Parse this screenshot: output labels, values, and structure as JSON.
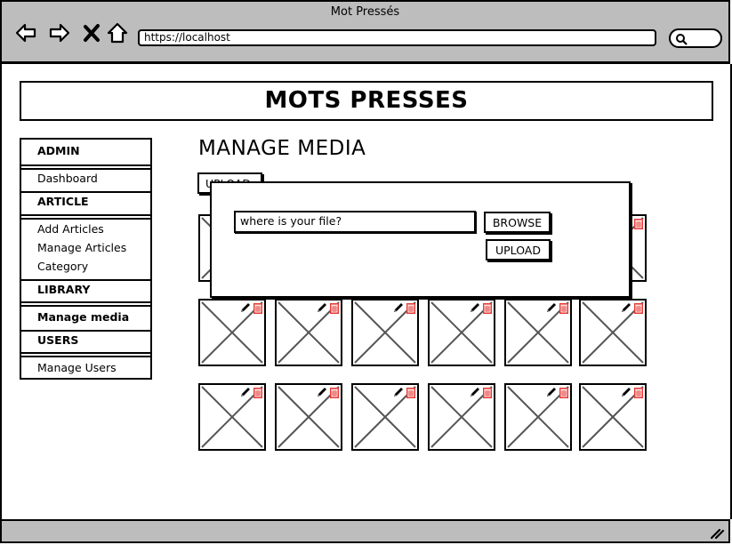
{
  "window": {
    "title": "Mot Pressés",
    "url": "https://localhost"
  },
  "app": {
    "title": "MOTS PRESSES"
  },
  "sidebar": {
    "sections": [
      {
        "heading": "ADMIN",
        "items": [
          "Dashboard"
        ]
      },
      {
        "heading": "ARTICLE",
        "items": [
          "Add Articles",
          "Manage Articles",
          "Category"
        ]
      },
      {
        "heading": "LIBRARY",
        "items": [
          "Manage media"
        ]
      },
      {
        "heading": "USERS",
        "items": [
          "Manage Users"
        ]
      }
    ],
    "active_item": "Manage media"
  },
  "main": {
    "title": "MANAGE MEDIA",
    "upload_label": "UPLOAD"
  },
  "dialog": {
    "file_placeholder": "where is your file?",
    "browse_label": "BROWSE",
    "upload_label": "UPLOAD"
  },
  "media_grid": {
    "rows": 3,
    "columns": 6,
    "tile_icons": [
      "pencil-icon",
      "trash-icon"
    ]
  },
  "colors": {
    "chrome": "#bdbdbd",
    "delete_icon": "#e53935"
  }
}
